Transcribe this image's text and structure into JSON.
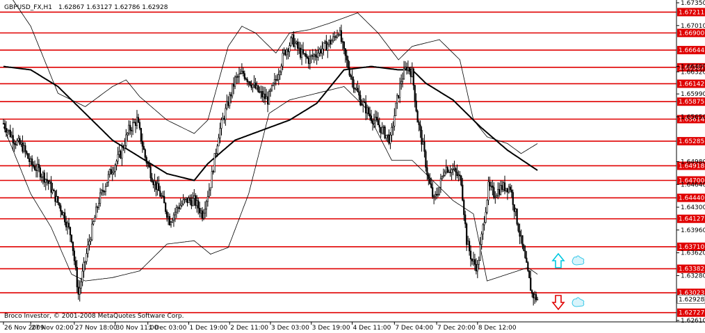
{
  "header": {
    "symbol": "GBPUSD_FX,H1",
    "ohlc": "1.62867 1.63127 1.62786 1.62928"
  },
  "footer": {
    "copyright": "Broco Investor, © 2001-2008 MetaQuotes Software Corp."
  },
  "colors": {
    "background": "#ffffff",
    "level_line": "#e00000",
    "level_label_bg": "#e00000",
    "candle": "#000000",
    "bollinger": "#000000",
    "moving_average": "#000000",
    "buy_arrow": "#00c8e0",
    "sell_arrow": "#e00000",
    "hand_icon": "#38c8e8",
    "current_price_label_bg": "#ffffff"
  },
  "icons": [
    "up-arrow-icon",
    "down-arrow-icon",
    "thumbs-up-hand-icon",
    "pointing-hand-icon"
  ],
  "chart_data": {
    "type": "candlestick",
    "title": "GBPUSD_FX,H1",
    "ylim": [
      1.6261,
      1.6735
    ],
    "y_ticks": [
      "1.67350",
      "1.67010",
      "1.66400",
      "1.66320",
      "1.65990",
      "1.65650",
      "1.64980",
      "1.64640",
      "1.64300",
      "1.63960",
      "1.63620",
      "1.63280",
      "1.62610"
    ],
    "x_ticks": [
      "26 Nov 2009",
      "27 Nov 02:00",
      "27 Nov 18:00",
      "30 Nov 11:00",
      "1 Dec 03:00",
      "1 Dec 19:00",
      "2 Dec 11:00",
      "3 Dec 03:00",
      "3 Dec 19:00",
      "4 Dec 11:00",
      "7 Dec 04:00",
      "7 Dec 20:00",
      "8 Dec 12:00"
    ],
    "levels": [
      "1.67211",
      "1.66900",
      "1.66644",
      "1.66387",
      "1.66142",
      "1.65875",
      "1.65614",
      "1.65285",
      "1.64918",
      "1.64700",
      "1.64440",
      "1.64127",
      "1.63710",
      "1.63382",
      "1.63023",
      "1.62727"
    ],
    "current_price": "1.62928",
    "close_path": [
      [
        0,
        1.6555
      ],
      [
        8,
        1.653
      ],
      [
        14,
        1.652
      ],
      [
        20,
        1.6495
      ],
      [
        26,
        1.6485
      ],
      [
        32,
        1.647
      ],
      [
        38,
        1.6445
      ],
      [
        44,
        1.642
      ],
      [
        50,
        1.6385
      ],
      [
        55,
        1.63
      ],
      [
        58,
        1.633
      ],
      [
        63,
        1.638
      ],
      [
        70,
        1.644
      ],
      [
        78,
        1.648
      ],
      [
        86,
        1.651
      ],
      [
        92,
        1.6545
      ],
      [
        98,
        1.656
      ],
      [
        104,
        1.6505
      ],
      [
        110,
        1.647
      ],
      [
        116,
        1.6445
      ],
      [
        122,
        1.641
      ],
      [
        128,
        1.643
      ],
      [
        134,
        1.644
      ],
      [
        140,
        1.644
      ],
      [
        146,
        1.642
      ],
      [
        152,
        1.6465
      ],
      [
        158,
        1.654
      ],
      [
        164,
        1.658
      ],
      [
        170,
        1.662
      ],
      [
        176,
        1.663
      ],
      [
        182,
        1.6615
      ],
      [
        188,
        1.66
      ],
      [
        194,
        1.659
      ],
      [
        200,
        1.662
      ],
      [
        206,
        1.666
      ],
      [
        212,
        1.668
      ],
      [
        218,
        1.666
      ],
      [
        224,
        1.665
      ],
      [
        230,
        1.666
      ],
      [
        236,
        1.667
      ],
      [
        242,
        1.668
      ],
      [
        246,
        1.6695
      ],
      [
        250,
        1.666
      ],
      [
        256,
        1.662
      ],
      [
        262,
        1.659
      ],
      [
        268,
        1.657
      ],
      [
        274,
        1.6555
      ],
      [
        280,
        1.654
      ],
      [
        284,
        1.653
      ],
      [
        288,
        1.658
      ],
      [
        292,
        1.662
      ],
      [
        296,
        1.664
      ],
      [
        300,
        1.663
      ],
      [
        304,
        1.656
      ],
      [
        308,
        1.652
      ],
      [
        312,
        1.647
      ],
      [
        316,
        1.644
      ],
      [
        320,
        1.646
      ],
      [
        324,
        1.649
      ],
      [
        330,
        1.6485
      ],
      [
        336,
        1.647
      ],
      [
        340,
        1.638
      ],
      [
        344,
        1.635
      ],
      [
        348,
        1.634
      ],
      [
        352,
        1.64
      ],
      [
        356,
        1.646
      ],
      [
        360,
        1.645
      ],
      [
        366,
        1.646
      ],
      [
        372,
        1.646
      ],
      [
        376,
        1.642
      ],
      [
        380,
        1.638
      ],
      [
        384,
        1.634
      ],
      [
        388,
        1.63
      ],
      [
        392,
        1.6293
      ]
    ],
    "moving_average": [
      [
        0,
        1.664
      ],
      [
        20,
        1.6635
      ],
      [
        40,
        1.661
      ],
      [
        60,
        1.657
      ],
      [
        80,
        1.653
      ],
      [
        100,
        1.6505
      ],
      [
        120,
        1.648
      ],
      [
        140,
        1.647
      ],
      [
        150,
        1.6495
      ],
      [
        170,
        1.653
      ],
      [
        190,
        1.6545
      ],
      [
        210,
        1.656
      ],
      [
        230,
        1.6585
      ],
      [
        250,
        1.6635
      ],
      [
        270,
        1.664
      ],
      [
        290,
        1.6635
      ],
      [
        300,
        1.6635
      ],
      [
        310,
        1.6615
      ],
      [
        330,
        1.659
      ],
      [
        350,
        1.655
      ],
      [
        370,
        1.6515
      ],
      [
        392,
        1.6485
      ]
    ],
    "bollinger_upper": [
      [
        0,
        1.676
      ],
      [
        20,
        1.67
      ],
      [
        40,
        1.66
      ],
      [
        60,
        1.658
      ],
      [
        80,
        1.661
      ],
      [
        90,
        1.662
      ],
      [
        100,
        1.6595
      ],
      [
        120,
        1.656
      ],
      [
        140,
        1.654
      ],
      [
        150,
        1.656
      ],
      [
        165,
        1.667
      ],
      [
        175,
        1.67
      ],
      [
        185,
        1.669
      ],
      [
        200,
        1.666
      ],
      [
        210,
        1.669
      ],
      [
        225,
        1.6695
      ],
      [
        240,
        1.6705
      ],
      [
        260,
        1.672
      ],
      [
        275,
        1.669
      ],
      [
        290,
        1.665
      ],
      [
        300,
        1.667
      ],
      [
        320,
        1.668
      ],
      [
        335,
        1.665
      ],
      [
        345,
        1.656
      ],
      [
        355,
        1.6535
      ],
      [
        370,
        1.6525
      ],
      [
        380,
        1.651
      ],
      [
        392,
        1.6525
      ]
    ],
    "bollinger_lower": [
      [
        0,
        1.655
      ],
      [
        20,
        1.645
      ],
      [
        35,
        1.64
      ],
      [
        50,
        1.633
      ],
      [
        60,
        1.632
      ],
      [
        80,
        1.6325
      ],
      [
        100,
        1.6335
      ],
      [
        120,
        1.6375
      ],
      [
        140,
        1.638
      ],
      [
        152,
        1.636
      ],
      [
        165,
        1.637
      ],
      [
        180,
        1.645
      ],
      [
        195,
        1.657
      ],
      [
        210,
        1.659
      ],
      [
        230,
        1.66
      ],
      [
        250,
        1.661
      ],
      [
        265,
        1.658
      ],
      [
        285,
        1.65
      ],
      [
        300,
        1.65
      ],
      [
        315,
        1.647
      ],
      [
        330,
        1.644
      ],
      [
        345,
        1.642
      ],
      [
        355,
        1.632
      ],
      [
        370,
        1.633
      ],
      [
        385,
        1.634
      ],
      [
        392,
        1.633
      ]
    ]
  }
}
